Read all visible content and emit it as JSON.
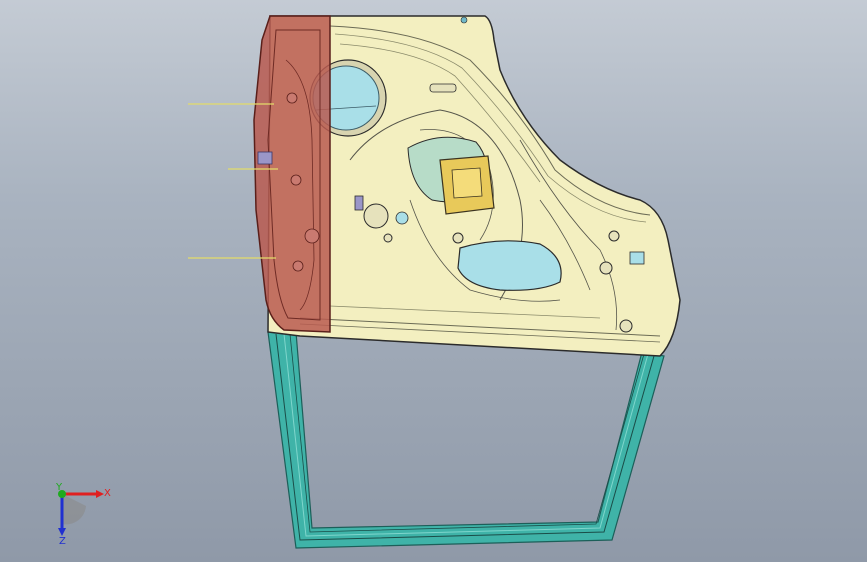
{
  "viewport": {
    "background_top": "#c4cbd4",
    "background_bottom": "#8f99a8"
  },
  "model": {
    "panel_color": "#f3efc0",
    "panel_outline": "#2b2b2b",
    "highlight_color": "#b85b50",
    "frame_color": "#3fb3a8",
    "glass_color": "#a9dfe8",
    "accent_yellow": "#e8c95a",
    "annotation_line_color": "#e3dc6a"
  },
  "triad": {
    "x_label": "X",
    "y_label": "Y",
    "z_label": "Z",
    "x_color": "#e02020",
    "y_color": "#1faa1f",
    "z_color": "#2030d0"
  }
}
